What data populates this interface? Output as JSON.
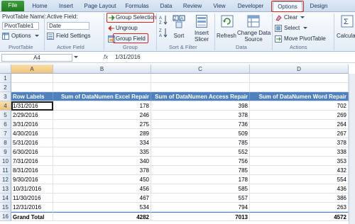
{
  "tabs": {
    "file": "File",
    "home": "Home",
    "insert": "Insert",
    "page_layout": "Page Layout",
    "formulas": "Formulas",
    "data": "Data",
    "review": "Review",
    "view": "View",
    "developer": "Developer",
    "options": "Options",
    "design": "Design"
  },
  "ribbon": {
    "pivottable_group": {
      "name_label": "PivotTable Name:",
      "name_value": "PivotTable1",
      "options_label": "Options",
      "group_label": "PivotTable"
    },
    "active_field_group": {
      "field_label": "Active Field:",
      "field_value": "Date",
      "settings_label": "Field Settings",
      "group_label": "Active Field"
    },
    "group_group": {
      "group_selection": "Group Selection",
      "ungroup": "Ungroup",
      "group_field": "Group Field",
      "group_label": "Group"
    },
    "sort_group": {
      "sort_label": "Sort",
      "insert_slicer_line1": "Insert",
      "insert_slicer_line2": "Slicer",
      "group_label": "Sort & Filter"
    },
    "data_group": {
      "refresh": "Refresh",
      "change_source_line1": "Change Data",
      "change_source_line2": "Source",
      "group_label": "Data"
    },
    "actions_group": {
      "clear": "Clear",
      "select": "Select",
      "move": "Move PivotTable",
      "group_label": "Actions"
    },
    "calculations": "Calculations"
  },
  "formula_bar": {
    "name_box": "A4",
    "fx": "fx",
    "value": "1/31/2016"
  },
  "grid": {
    "columns": [
      "A",
      "B",
      "C",
      "D"
    ],
    "rows": [
      "1",
      "2",
      "3",
      "4",
      "5",
      "6",
      "7",
      "8",
      "9",
      "10",
      "11",
      "12",
      "13",
      "14",
      "15",
      "16"
    ],
    "headers": [
      "Row Labels",
      "Sum of DataNumen Excel Repair",
      "Sum of DataNumen Access Repair",
      "Sum of DataNumen Word Repair"
    ],
    "data_rows": [
      [
        "1/31/2016",
        "178",
        "398",
        "702"
      ],
      [
        "2/29/2016",
        "246",
        "378",
        "269"
      ],
      [
        "3/31/2016",
        "275",
        "736",
        "264"
      ],
      [
        "4/30/2016",
        "289",
        "509",
        "267"
      ],
      [
        "5/31/2016",
        "334",
        "785",
        "378"
      ],
      [
        "6/30/2016",
        "335",
        "552",
        "338"
      ],
      [
        "7/31/2016",
        "340",
        "756",
        "353"
      ],
      [
        "8/31/2016",
        "378",
        "785",
        "432"
      ],
      [
        "9/30/2016",
        "450",
        "178",
        "554"
      ],
      [
        "10/31/2016",
        "456",
        "585",
        "436"
      ],
      [
        "11/30/2016",
        "467",
        "557",
        "386"
      ],
      [
        "12/31/2016",
        "534",
        "794",
        "263"
      ]
    ],
    "total_row": [
      "Grand Total",
      "4282",
      "7013",
      "4572"
    ]
  },
  "colors": {
    "accent_header": "#4f81bd",
    "highlight_box": "#d7261b",
    "file_tab": "#217a22"
  }
}
